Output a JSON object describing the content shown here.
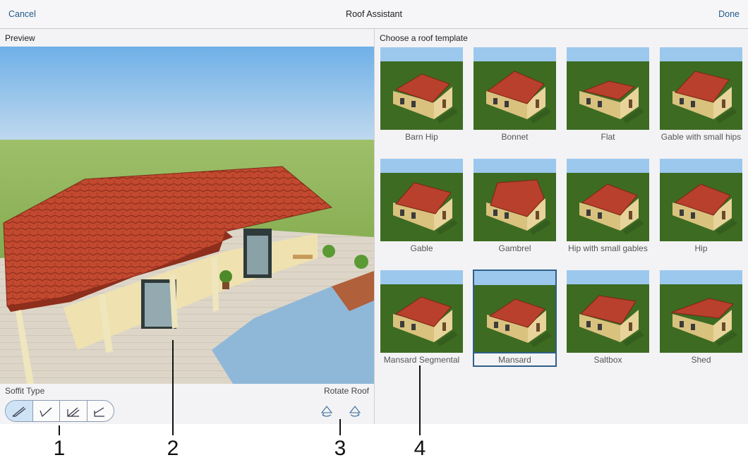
{
  "topbar": {
    "cancel": "Cancel",
    "title": "Roof Assistant",
    "done": "Done"
  },
  "preview": {
    "label": "Preview"
  },
  "soffit": {
    "label": "Soffit Type",
    "options": [
      {
        "icon": "soffit-type-1-icon",
        "selected": true
      },
      {
        "icon": "soffit-type-2-icon",
        "selected": false
      },
      {
        "icon": "soffit-type-3-icon",
        "selected": false
      },
      {
        "icon": "soffit-type-4-icon",
        "selected": false
      }
    ]
  },
  "rotate": {
    "label": "Rotate Roof",
    "left_icon": "rotate-left-icon",
    "right_icon": "rotate-right-icon"
  },
  "templates": {
    "label": "Choose a roof template",
    "items": [
      {
        "label": "Barn Hip"
      },
      {
        "label": "Bonnet"
      },
      {
        "label": "Flat"
      },
      {
        "label": "Gable with small hips"
      },
      {
        "label": "Gable"
      },
      {
        "label": "Gambrel"
      },
      {
        "label": "Hip with small gables"
      },
      {
        "label": "Hip"
      },
      {
        "label": "Mansard Segmental"
      },
      {
        "label": "Mansard",
        "selected": true
      },
      {
        "label": "Saltbox"
      },
      {
        "label": "Shed"
      }
    ]
  },
  "callouts": [
    "1",
    "2",
    "3",
    "4"
  ],
  "colors": {
    "accent": "#1e5a8c",
    "selected_border": "#2f5f8a",
    "roof": "#b8402c",
    "wall": "#e8d49a",
    "grass": "#3d6b22",
    "sky": "#9cc8ee"
  }
}
